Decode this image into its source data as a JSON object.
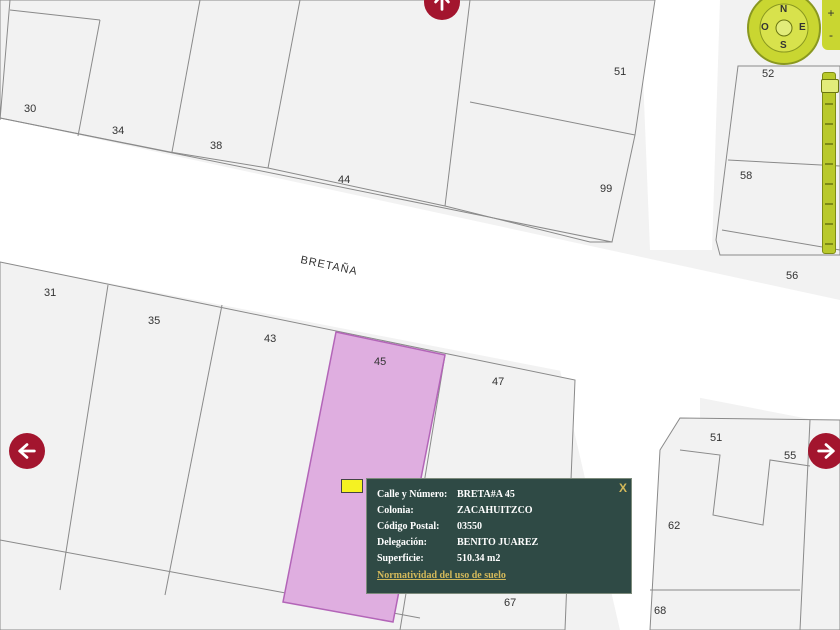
{
  "map": {
    "street_name": "BRETAÑA",
    "lot_numbers": [
      "30",
      "34",
      "38",
      "44",
      "51",
      "99",
      "31",
      "35",
      "43",
      "45",
      "47",
      "52",
      "58",
      "56",
      "51",
      "55",
      "62",
      "68",
      "67"
    ],
    "highlight_color": "#dfaee0",
    "parcel_fill": "#f2f2f2",
    "line_color": "#8a8a8a"
  },
  "compass": {
    "n": "N",
    "s": "S",
    "e": "E",
    "o": "O"
  },
  "zoom": {
    "plus": "+",
    "minus": "-"
  },
  "colors": {
    "nav_arrow": "#a3152e",
    "popup_bg": "#2f4a45",
    "link": "#d4b95a",
    "control_green": "#c9d631"
  },
  "popup": {
    "close": "X",
    "rows": [
      {
        "label": "Calle y Número:",
        "value": "BRETA#A 45"
      },
      {
        "label": "Colonia:",
        "value": "ZACAHUITZCO"
      },
      {
        "label": "Código Postal:",
        "value": "03550"
      },
      {
        "label": "Delegación:",
        "value": "BENITO JUAREZ"
      },
      {
        "label": "Superficie:",
        "value": "510.34 m2"
      }
    ],
    "link": "Normatividad del uso de suelo"
  }
}
